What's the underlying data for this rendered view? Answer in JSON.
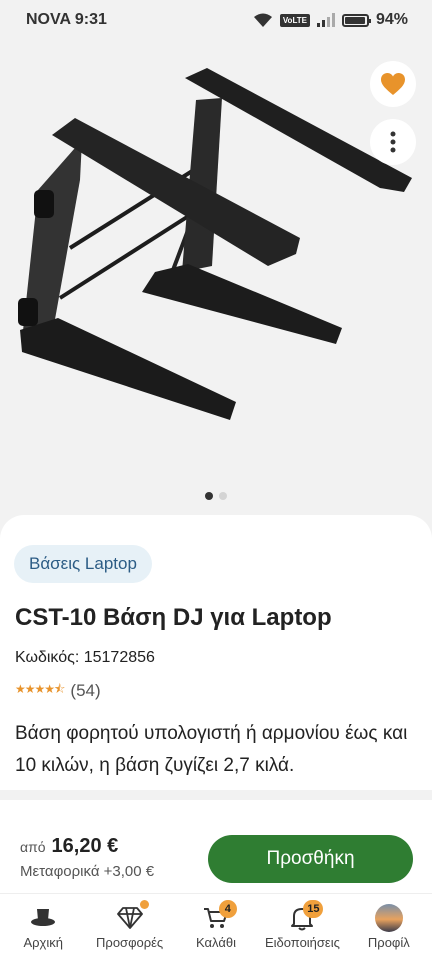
{
  "status_bar": {
    "carrier_time": "NOVA 9:31",
    "volte": "VoLTE",
    "battery": "94%",
    "battery_level": 0.94
  },
  "gallery": {
    "image": "laptop-stand-photo",
    "slide_count": 2,
    "active_slide": 1,
    "favorite_icon": "heart-icon",
    "more_icon": "more-vertical-icon"
  },
  "product": {
    "category": "Βάσεις Laptop",
    "title": "CST-10 Βάση DJ για Laptop",
    "code": "Κωδικός: 15172856",
    "rating": 4.5,
    "reviews": "(54)",
    "description": "Βάση φορητού υπολογιστή ή αρμονίου έως και 10 κιλών, η βάση ζυγίζει 2,7 κιλά."
  },
  "purchase": {
    "from_label": "από",
    "price": "16,20 €",
    "shipping": "Μεταφορικά +3,00 €",
    "add_button": "Προσθήκη"
  },
  "bottom_nav": {
    "items": [
      {
        "label": "Αρχική",
        "icon": "hat-icon"
      },
      {
        "label": "Προσφορές",
        "icon": "diamond-icon"
      },
      {
        "label": "Καλάθι",
        "icon": "cart-icon",
        "badge": "4"
      },
      {
        "label": "Ειδοποιήσεις",
        "icon": "bell-icon",
        "badge": "15"
      },
      {
        "label": "Προφίλ",
        "icon": "avatar-icon"
      }
    ]
  },
  "colors": {
    "accent_orange": "#f0a03c",
    "button_green": "#2f7d32",
    "chip_bg": "#e7f1f7",
    "chip_text": "#2c5c85"
  }
}
